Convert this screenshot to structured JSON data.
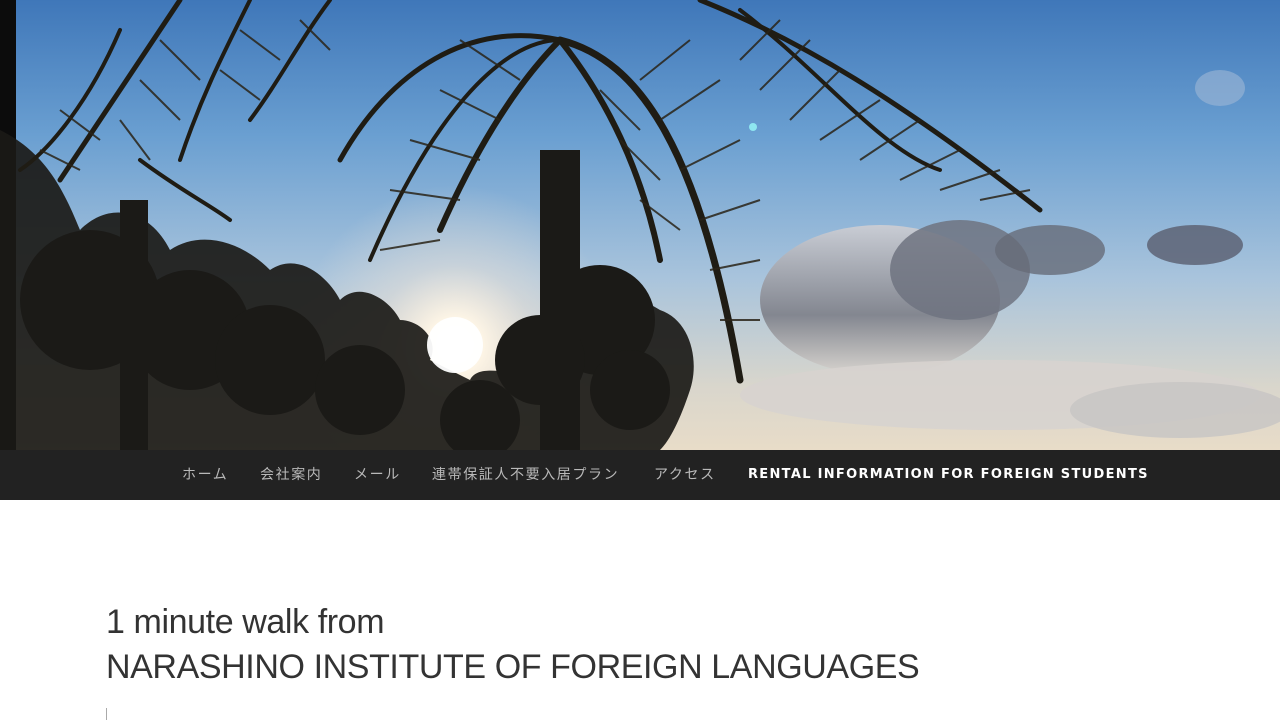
{
  "header": {
    "banner_image": "palm-trees-sunset-sky"
  },
  "nav": {
    "items": [
      {
        "label": "ホーム"
      },
      {
        "label": "会社案内"
      },
      {
        "label": "メール"
      },
      {
        "label": "連帯保証人不要入居プラン"
      },
      {
        "label": "アクセス"
      },
      {
        "label": "RENTAL INFORMATION FOR FOREIGN STUDENTS",
        "active": true
      }
    ]
  },
  "main": {
    "title_line1": "1 minute walk from",
    "title_line2": "NARASHINO INSTITUTE OF FOREIGN LANGUAGES"
  },
  "colors": {
    "nav_bg": "#222222",
    "nav_text": "#b9b9b9",
    "nav_active": "#ffffff",
    "title_text": "#333333"
  }
}
